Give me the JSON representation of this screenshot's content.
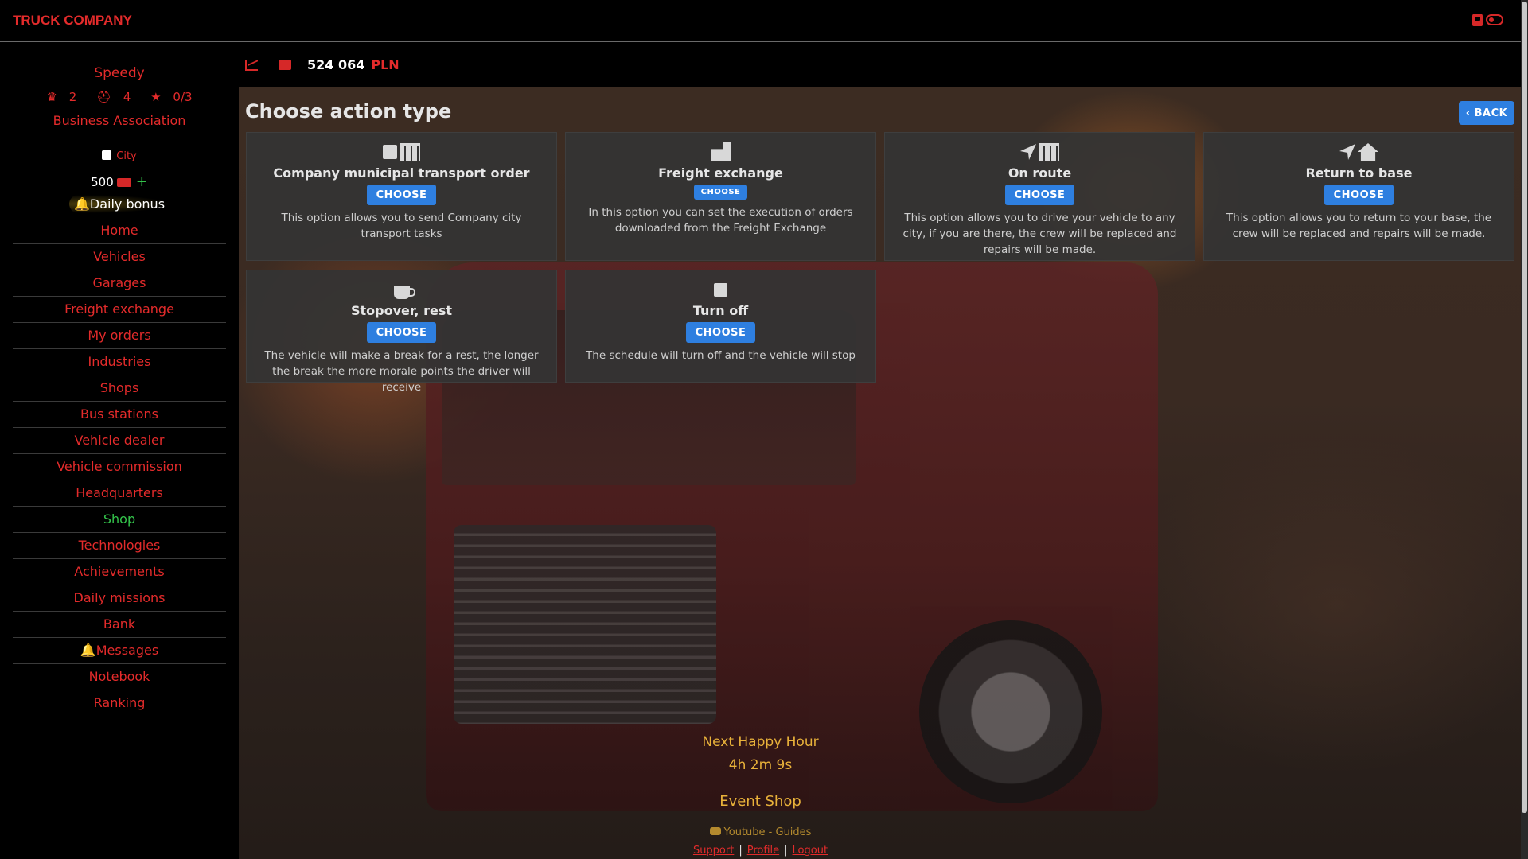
{
  "app": {
    "brand": "TRUCK COMPANY",
    "accent_color": "#e32b2b",
    "button_color": "#2e7fe0"
  },
  "sidebar": {
    "username": "Speedy",
    "stats": {
      "crowns": "2",
      "hats": "4",
      "stars": "0/3"
    },
    "association": "Business Association",
    "city_label": "City",
    "balance": "500",
    "daily_bonus": "Daily bonus",
    "items": [
      {
        "label": "Home"
      },
      {
        "label": "Vehicles"
      },
      {
        "label": "Garages"
      },
      {
        "label": "Freight exchange"
      },
      {
        "label": "My orders"
      },
      {
        "label": "Industries"
      },
      {
        "label": "Shops"
      },
      {
        "label": "Bus stations"
      },
      {
        "label": "Vehicle dealer"
      },
      {
        "label": "Vehicle commission"
      },
      {
        "label": "Headquarters"
      },
      {
        "label": "Shop"
      },
      {
        "label": "Technologies"
      },
      {
        "label": "Achievements"
      },
      {
        "label": "Daily missions"
      },
      {
        "label": "Bank"
      },
      {
        "label": "Messages"
      },
      {
        "label": "Notebook"
      },
      {
        "label": "Ranking"
      }
    ]
  },
  "money": {
    "value": "524 064",
    "currency": "PLN"
  },
  "main": {
    "title": "Choose action type",
    "back_label": "BACK",
    "cards": [
      {
        "title": "Company municipal transport order",
        "button": "CHOOSE",
        "description": "This option allows you to send Company city transport tasks",
        "icons": [
          "calendar-icon",
          "building-icon"
        ]
      },
      {
        "title": "Freight exchange",
        "button": "CHOOSE",
        "description": "In this option you can set the execution of orders downloaded from the Freight Exchange",
        "icons": [
          "warehouse-icon"
        ]
      },
      {
        "title": "On route",
        "button": "CHOOSE",
        "description": "This option allows you to drive your vehicle to any city, if you are there, the crew will be replaced and repairs will be made.",
        "icons": [
          "location-arrow-icon",
          "building-icon"
        ]
      },
      {
        "title": "Return to base",
        "button": "CHOOSE",
        "description": "This option allows you to return to your base, the crew will be replaced and repairs will be made.",
        "icons": [
          "location-arrow-icon",
          "house-icon"
        ]
      },
      {
        "title": "Stopover, rest",
        "button": "CHOOSE",
        "description": "The vehicle will make a break for a rest, the longer the break the more morale points the driver will receive",
        "icons": [
          "coffee-icon"
        ]
      },
      {
        "title": "Turn off",
        "button": "CHOOSE",
        "description": "The schedule will turn off and the vehicle will stop",
        "icons": [
          "stop-icon"
        ]
      }
    ]
  },
  "footer": {
    "happy_hour_label": "Next Happy Hour",
    "happy_hour_time": "4h 2m 9s",
    "event_shop": "Event Shop",
    "youtube": "Youtube - Guides",
    "links": {
      "support": "Support",
      "profile": "Profile",
      "logout": "Logout"
    },
    "separator": "|"
  }
}
